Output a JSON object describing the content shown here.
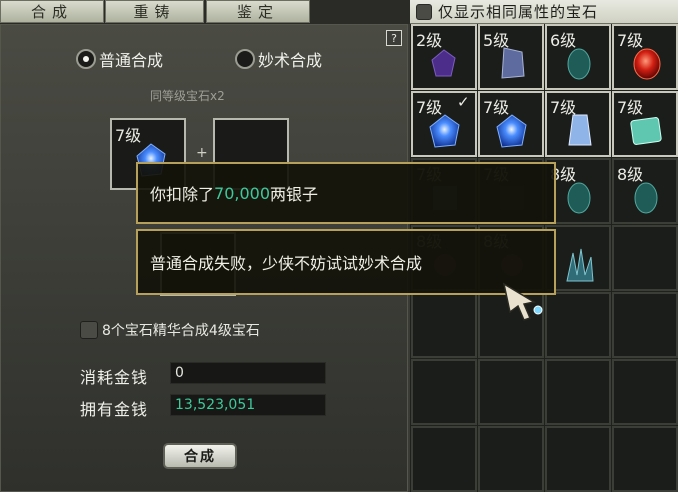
{
  "tabs": [
    "合成",
    "重铸",
    "鉴定"
  ],
  "filter": {
    "label": "仅显示相同属性的宝石"
  },
  "help_label": "?",
  "mode": {
    "normal": "普通合成",
    "magic": "妙术合成"
  },
  "subtitle": "同等级宝石x2",
  "slot": {
    "level": "7级"
  },
  "essence_label": "8个宝石精华合成4级宝石",
  "cost": {
    "label": "消耗金钱",
    "value": "0"
  },
  "money": {
    "label": "拥有金钱",
    "value": "13,523,051"
  },
  "merge_button": "合成",
  "tooltips": {
    "deduct_prefix": "你扣除了",
    "deduct_amount": "70,000",
    "deduct_suffix": "两银子",
    "result": "普通合成失败，少侠不妨试试妙术合成"
  },
  "inventory": [
    {
      "level": "2级",
      "gem": "purple-gem"
    },
    {
      "level": "5级",
      "gem": "blue-gem"
    },
    {
      "level": "6级",
      "gem": "teal-gem"
    },
    {
      "level": "7级",
      "gem": "red-gem"
    },
    {
      "level": "7级",
      "gem": "sapphire-gem",
      "check": "✓"
    },
    {
      "level": "7级",
      "gem": "sapphire-gem"
    },
    {
      "level": "7级",
      "gem": "crystal-gem"
    },
    {
      "level": "7级",
      "gem": "emerald-gem"
    },
    {
      "level": "7级",
      "gem": "emerald-gem"
    },
    {
      "level": "7级",
      "gem": "dark-gem"
    },
    {
      "level": "8级",
      "gem": "teal-gem"
    },
    {
      "level": "8级",
      "gem": "teal-gem"
    },
    {
      "level": "8级",
      "gem": "brown-gem"
    },
    {
      "level": "8级",
      "gem": "brown-gem"
    },
    {
      "level": "",
      "gem": "crystal-cluster"
    }
  ],
  "colors": {
    "accent_gold": "#b7a05a",
    "money_cyan": "#3cc99b"
  }
}
